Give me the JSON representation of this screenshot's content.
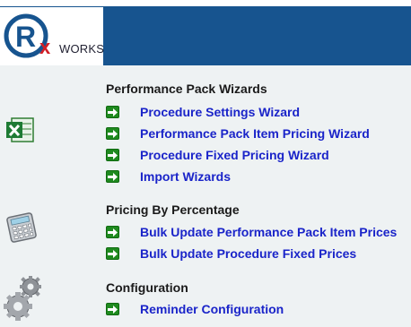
{
  "logo": {
    "letter": "R",
    "x_mark": "x",
    "suffix": "WORKS"
  },
  "sections": [
    {
      "icon": "excel-icon",
      "title": "Performance Pack Wizards",
      "links": [
        "Procedure Settings Wizard",
        "Performance Pack Item Pricing Wizard",
        "Procedure Fixed Pricing Wizard",
        "Import Wizards"
      ]
    },
    {
      "icon": "calculator-icon",
      "title": "Pricing By Percentage",
      "links": [
        "Bulk Update Performance Pack Item Prices",
        "Bulk Update Procedure Fixed Prices"
      ]
    },
    {
      "icon": "gears-icon",
      "title": "Configuration",
      "links": [
        "Reminder Configuration"
      ]
    }
  ],
  "colors": {
    "header": "#17548f",
    "link": "#1a24c9",
    "arrow": "#1f8a1f"
  }
}
